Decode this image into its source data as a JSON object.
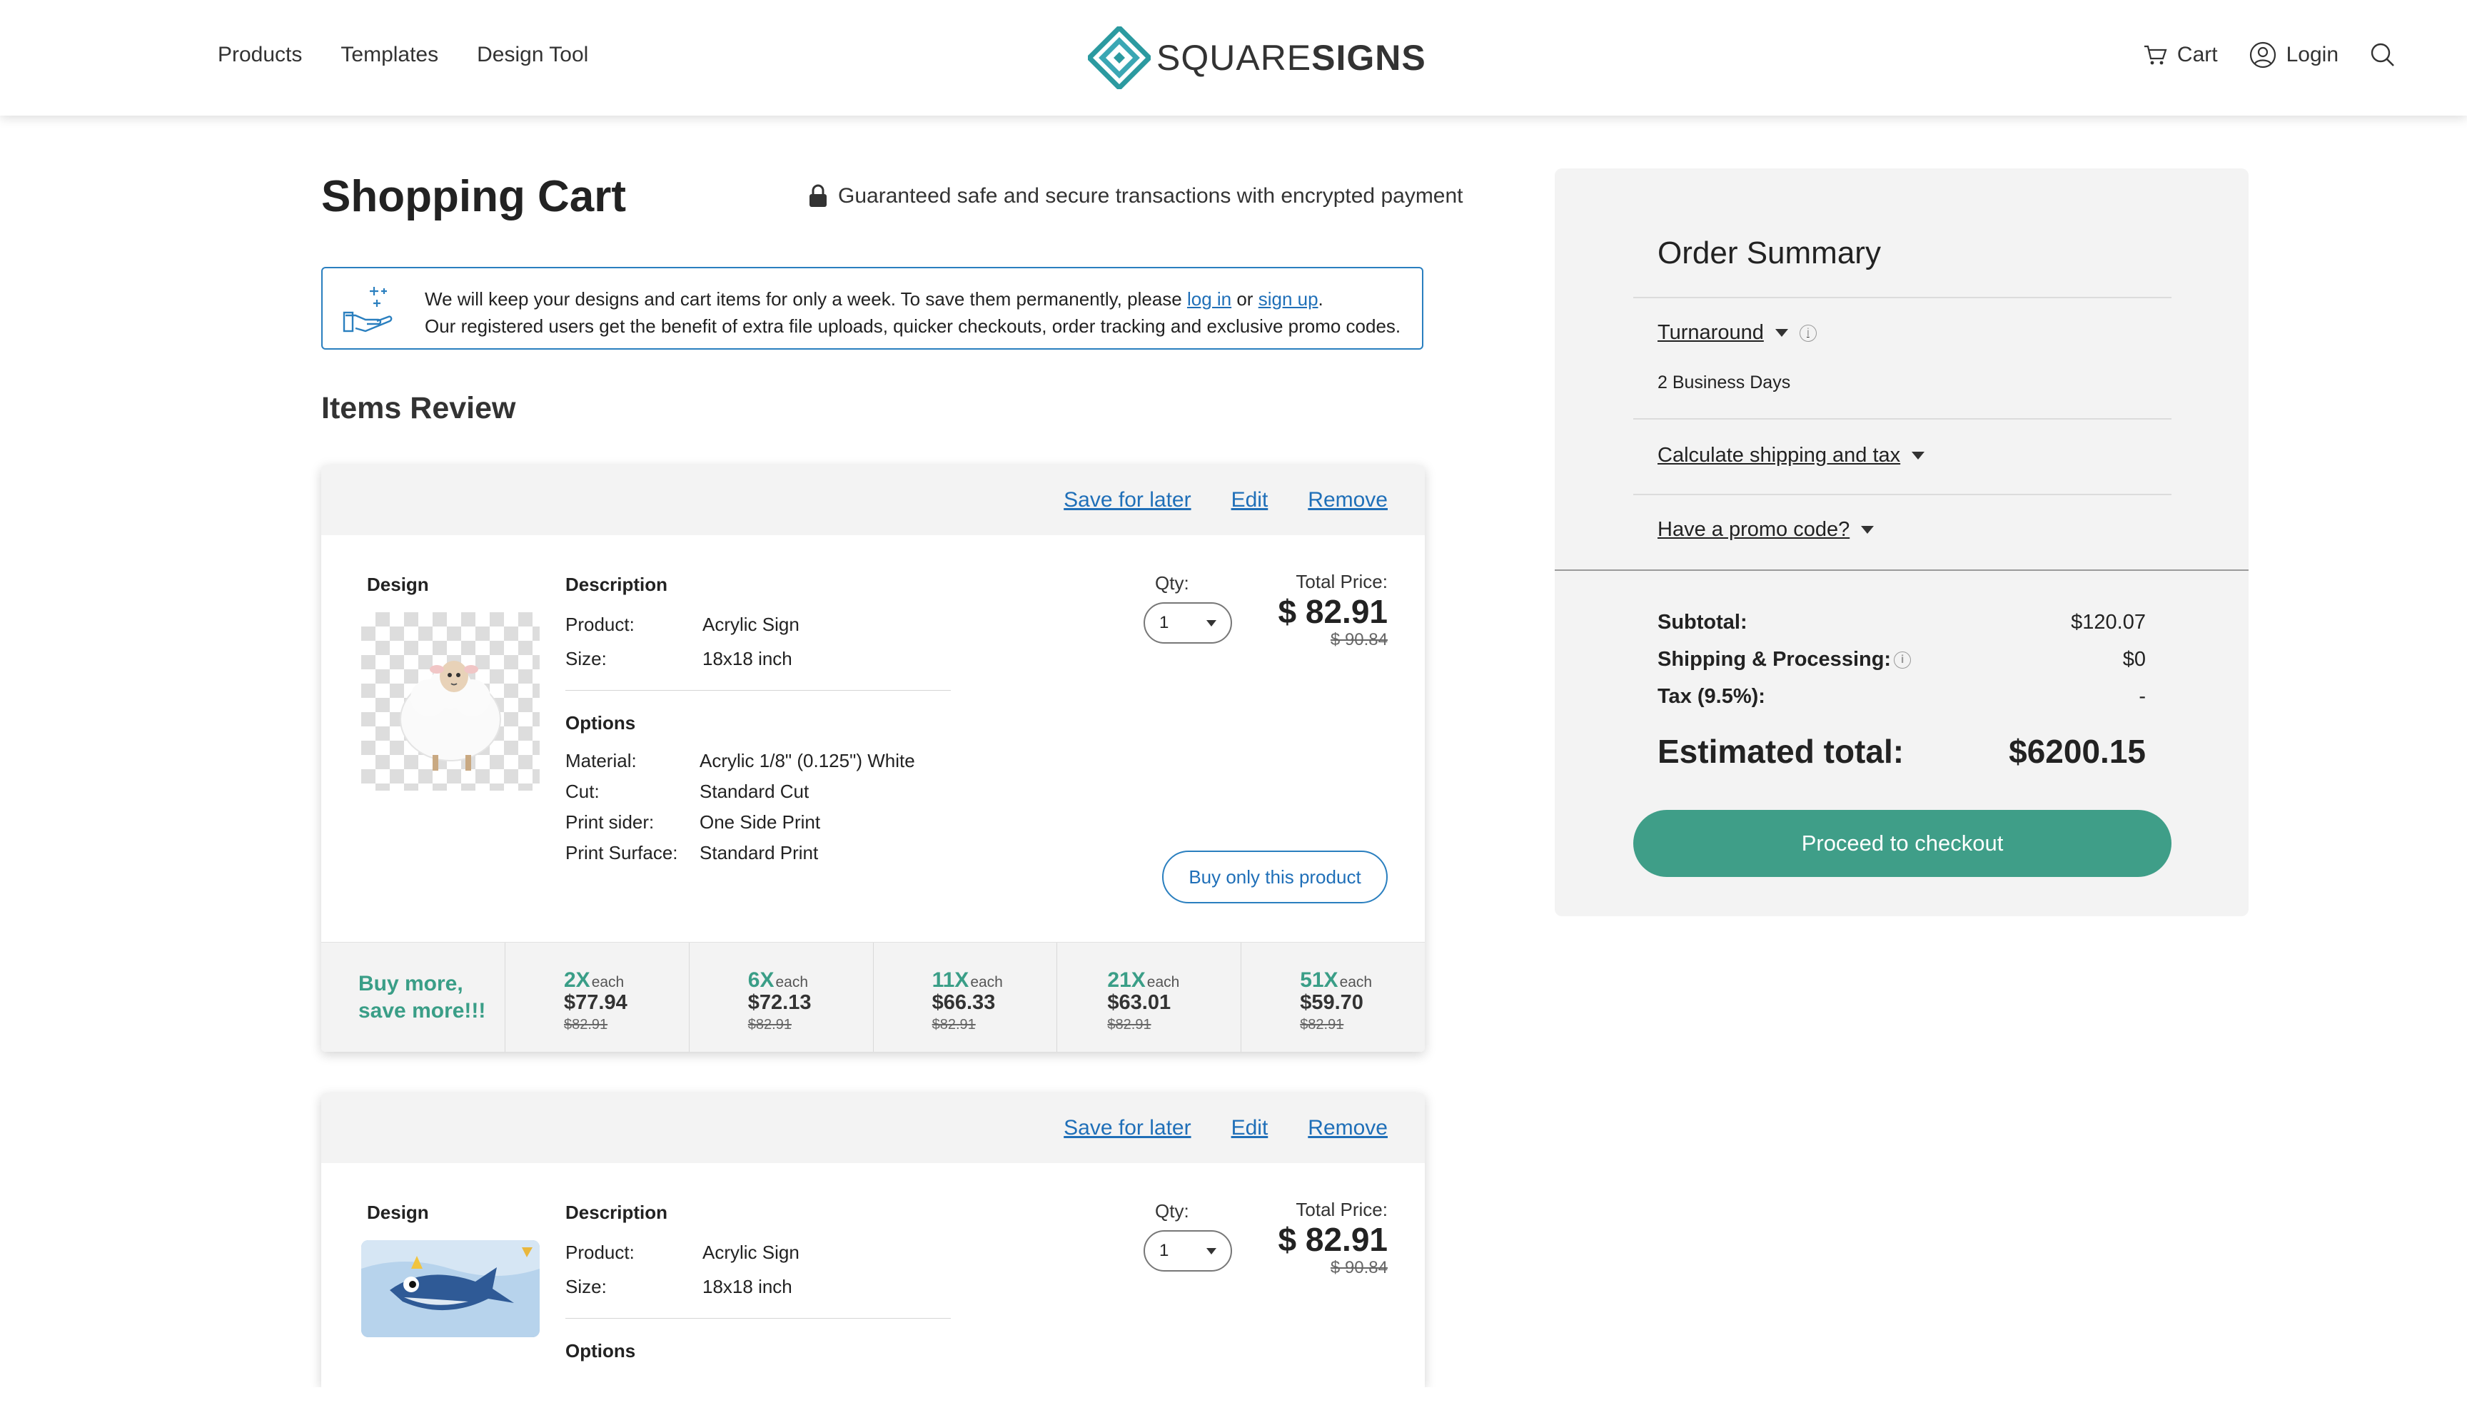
{
  "header": {
    "nav_left": [
      "Products",
      "Templates",
      "Design Tool"
    ],
    "logo": {
      "light": "SQUARE",
      "bold": "SIGNS"
    },
    "cart_label": "Cart",
    "login_label": "Login"
  },
  "page": {
    "title": "Shopping Cart",
    "secure_text": "Guaranteed safe and secure transactions with encrypted payment",
    "notice": {
      "line1_before": "We will keep your designs and cart items for only a week. To save them permanently, please ",
      "login_link": "log in",
      "or_text": " or ",
      "signup_link": "sign up",
      "period": ".",
      "line2": "Our registered users get the benefit of extra file uploads, quicker checkouts, order tracking and exclusive promo codes."
    },
    "items_review": "Items Review"
  },
  "items": [
    {
      "actions": {
        "save": "Save for later",
        "edit": "Edit",
        "remove": "Remove"
      },
      "design_label": "Design",
      "description_label": "Description",
      "product_key": "Product:",
      "product": "Acrylic Sign",
      "size_key": "Size:",
      "size": "18x18 inch",
      "options_label": "Options",
      "options": [
        {
          "k": "Material:",
          "v": "Acrylic 1/8\" (0.125\") White"
        },
        {
          "k": "Cut:",
          "v": "Standard Cut"
        },
        {
          "k": "Print sider:",
          "v": "One Side Print"
        },
        {
          "k": "Print Surface:",
          "v": "Standard Print"
        }
      ],
      "qty_label": "Qty:",
      "qty": "1",
      "total_label": "Total Price:",
      "total": "$ 82.91",
      "old_total": "$ 90.84",
      "buy_only": "Buy only this product",
      "tiers_label_1": "Buy more,",
      "tiers_label_2": "save more!!!",
      "tiers": [
        {
          "mult": "2X",
          "each": "each",
          "price": "$77.94",
          "was": "$82.91"
        },
        {
          "mult": "6X",
          "each": "each",
          "price": "$72.13",
          "was": "$82.91"
        },
        {
          "mult": "11X",
          "each": "each",
          "price": "$66.33",
          "was": "$82.91"
        },
        {
          "mult": "21X",
          "each": "each",
          "price": "$63.01",
          "was": "$82.91"
        },
        {
          "mult": "51X",
          "each": "each",
          "price": "$59.70",
          "was": "$82.91"
        }
      ]
    },
    {
      "actions": {
        "save": "Save for later",
        "edit": "Edit",
        "remove": "Remove"
      },
      "design_label": "Design",
      "description_label": "Description",
      "product_key": "Product:",
      "product": "Acrylic Sign",
      "size_key": "Size:",
      "size": "18x18 inch",
      "options_label": "Options",
      "qty_label": "Qty:",
      "qty": "1",
      "total_label": "Total Price:",
      "total": "$ 82.91",
      "old_total": "$ 90.84"
    }
  ],
  "summary": {
    "title": "Order Summary",
    "turnaround_label": "Turnaround",
    "turnaround_value": "2 Business Days",
    "shipping_link": "Calculate shipping and tax",
    "promo_link": "Have a promo code?",
    "subtotal_label": "Subtotal:",
    "subtotal": "$120.07",
    "shipping_label": "Shipping & Processing:",
    "shipping": "$0",
    "tax_label": "Tax (9.5%):",
    "tax": "-",
    "est_label": "Estimated total:",
    "est": "$6200.15",
    "checkout": "Proceed to checkout"
  },
  "colors": {
    "accent_green": "#3f9e88",
    "link_blue": "#1f6fb8",
    "logo_teal": "#2b9aa0"
  }
}
